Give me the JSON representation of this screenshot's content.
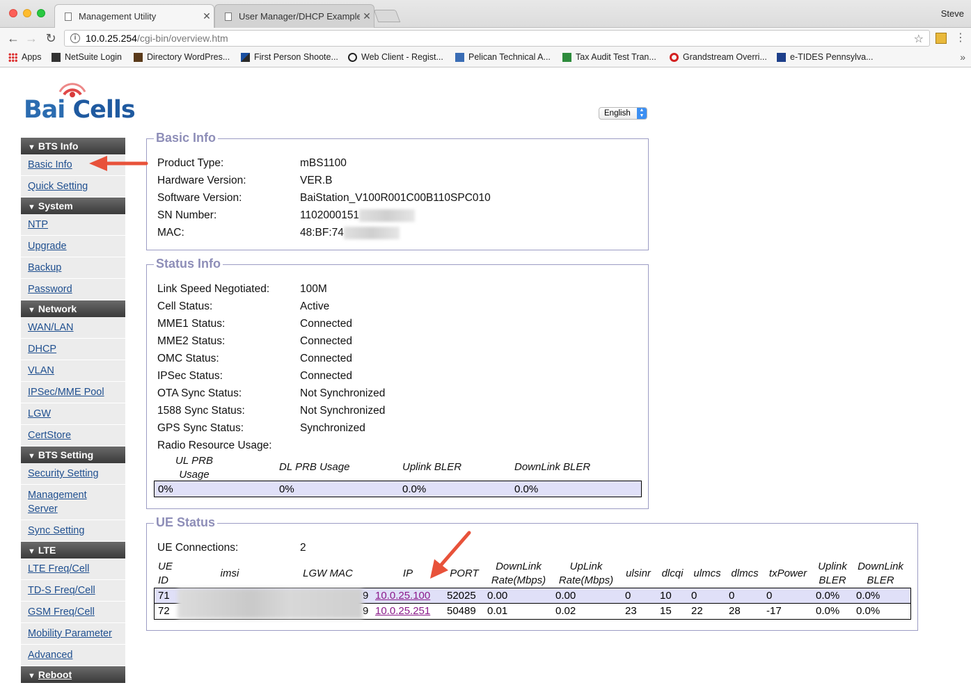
{
  "browser": {
    "tabs": [
      {
        "label": "Management Utility",
        "active": true
      },
      {
        "label": "User Manager/DHCP Example",
        "active": false
      }
    ],
    "profile": "Steve",
    "url_host": "10.0.25.254",
    "url_path": "/cgi-bin/overview.htm",
    "bookmarks": [
      "Apps",
      "NetSuite Login",
      "Directory WordPres...",
      "First Person Shoote...",
      "Web Client - Regist...",
      "Pelican Technical A...",
      "Tax Audit Test Tran...",
      "Grandstream Overri...",
      "e-TIDES Pennsylva..."
    ]
  },
  "logo": {
    "part1": "Bai",
    "part2": "Cells"
  },
  "language": {
    "selected": "English"
  },
  "sidebar": {
    "sections": [
      {
        "title": "BTS Info",
        "items": [
          "Basic Info",
          "Quick Setting"
        ]
      },
      {
        "title": "System",
        "items": [
          "NTP",
          "Upgrade",
          "Backup",
          "Password"
        ]
      },
      {
        "title": "Network",
        "items": [
          "WAN/LAN",
          "DHCP",
          "VLAN",
          "IPSec/MME Pool",
          "LGW",
          "CertStore"
        ]
      },
      {
        "title": "BTS Setting",
        "items": [
          "Security Setting",
          "Management Server",
          "Sync Setting"
        ]
      },
      {
        "title": "LTE",
        "items": [
          "LTE Freq/Cell",
          "TD-S Freq/Cell",
          "GSM Freq/Cell",
          "Mobility Parameter",
          "Advanced"
        ]
      },
      {
        "title": "Reboot",
        "items": []
      }
    ]
  },
  "basic_info": {
    "legend": "Basic Info",
    "rows": [
      {
        "key": "Product Type:",
        "value": "mBS1100"
      },
      {
        "key": "Hardware Version:",
        "value": "VER.B"
      },
      {
        "key": "Software Version:",
        "value": "BaiStation_V100R001C00B110SPC010"
      },
      {
        "key": "SN Number:",
        "value": "1102000151"
      },
      {
        "key": "MAC:",
        "value": "48:BF:74"
      }
    ]
  },
  "status_info": {
    "legend": "Status Info",
    "rows": [
      {
        "key": "Link Speed Negotiated:",
        "value": "100M"
      },
      {
        "key": "Cell Status:",
        "value": "Active"
      },
      {
        "key": "MME1 Status:",
        "value": "Connected"
      },
      {
        "key": "MME2 Status:",
        "value": "Connected"
      },
      {
        "key": "OMC Status:",
        "value": "Connected"
      },
      {
        "key": "IPSec Status:",
        "value": "Connected"
      },
      {
        "key": "OTA Sync Status:",
        "value": "Not Synchronized"
      },
      {
        "key": "1588 Sync Status:",
        "value": "Not Synchronized"
      },
      {
        "key": "GPS Sync Status:",
        "value": "Synchronized"
      },
      {
        "key": "Radio Resource Usage:",
        "value": ""
      }
    ],
    "usage_headers": [
      "UL PRB Usage",
      "DL PRB Usage",
      "Uplink BLER",
      "DownLink BLER"
    ],
    "usage_values": [
      "0%",
      "0%",
      "0.0%",
      "0.0%"
    ]
  },
  "ue_status": {
    "legend": "UE Status",
    "connections_label": "UE Connections:",
    "connections_value": "2",
    "headers": {
      "ue_id": "UE ID",
      "imsi": "imsi",
      "lgw_mac": "LGW MAC",
      "ip": "IP",
      "port": "PORT",
      "downlink_rate": "DownLink Rate(Mbps)",
      "uplink_rate": "UpLink Rate(Mbps)",
      "ulsinr": "ulsinr",
      "dlcqi": "dlcqi",
      "ulmcs": "ulmcs",
      "dlmcs": "dlmcs",
      "txpower": "txPower",
      "uplink_bler": "Uplink BLER",
      "downlink_bler": "DownLink BLER"
    },
    "rows": [
      {
        "ue_id": "71",
        "mac_tail": "9",
        "ip": "10.0.25.100",
        "port": "52025",
        "downlink_rate": "0.00",
        "uplink_rate": "0.00",
        "ulsinr": "0",
        "dlcqi": "10",
        "ulmcs": "0",
        "dlmcs": "0",
        "txpower": "0",
        "uplink_bler": "0.0%",
        "downlink_bler": "0.0%"
      },
      {
        "ue_id": "72",
        "mac_tail": "9",
        "ip": "10.0.25.251",
        "port": "50489",
        "downlink_rate": "0.01",
        "uplink_rate": "0.02",
        "ulsinr": "23",
        "dlcqi": "15",
        "ulmcs": "22",
        "dlmcs": "28",
        "txpower": "-17",
        "uplink_bler": "0.0%",
        "downlink_bler": "0.0%"
      }
    ]
  },
  "colors": {
    "legend": "#8e8eb8",
    "link": "#1f4f8f",
    "visited_link": "#8b1a8b",
    "annotation_arrow": "#e8523a",
    "row_highlight": "#e0e0f8"
  }
}
